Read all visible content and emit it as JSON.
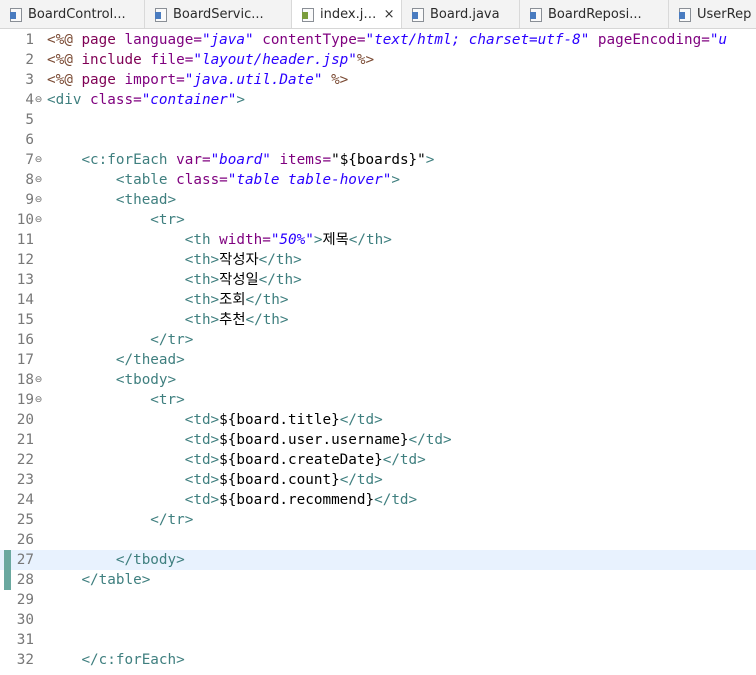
{
  "tabs": [
    {
      "label": "BoardControl...",
      "icon": "java-file-icon",
      "active": false
    },
    {
      "label": "BoardServic...",
      "icon": "java-file-icon",
      "active": false
    },
    {
      "label": "index.jsp",
      "icon": "jsp-file-icon",
      "active": true,
      "close": "×"
    },
    {
      "label": "Board.java",
      "icon": "java-file-icon",
      "active": false
    },
    {
      "label": "BoardReposi...",
      "icon": "java-file-icon",
      "active": false
    },
    {
      "label": "UserRep",
      "icon": "java-file-icon",
      "active": false
    }
  ],
  "editor": {
    "current_line": 27,
    "colors": {
      "current_line_bg": "#e8f2fe",
      "marker": "#6aa89f"
    },
    "lines": [
      {
        "n": "1",
        "fold": "",
        "segs": [
          [
            "c-dir",
            "<%@ "
          ],
          [
            "c-kw",
            "page "
          ],
          [
            "c-attr",
            "language="
          ],
          [
            "c-str",
            "\"java\" "
          ],
          [
            "c-attr",
            "contentType="
          ],
          [
            "c-str",
            "\"text/html; charset=utf-8\" "
          ],
          [
            "c-attr",
            "pageEncoding="
          ],
          [
            "c-str",
            "\"u"
          ]
        ]
      },
      {
        "n": "2",
        "fold": "",
        "segs": [
          [
            "c-dir",
            "<%@ "
          ],
          [
            "c-kw",
            "include "
          ],
          [
            "c-attr",
            "file="
          ],
          [
            "c-str",
            "\"layout/header.jsp\""
          ],
          [
            "c-dir",
            "%>"
          ]
        ]
      },
      {
        "n": "3",
        "fold": "",
        "segs": [
          [
            "c-dir",
            "<%@ "
          ],
          [
            "c-kw",
            "page "
          ],
          [
            "c-attr",
            "import="
          ],
          [
            "c-str",
            "\"java.util.Date\" "
          ],
          [
            "c-dir",
            "%>"
          ]
        ]
      },
      {
        "n": "4",
        "fold": "⊖",
        "segs": [
          [
            "c-tag",
            "<div "
          ],
          [
            "c-attr",
            "class="
          ],
          [
            "c-str",
            "\"container\""
          ],
          [
            "c-tag",
            ">"
          ]
        ]
      },
      {
        "n": "5",
        "fold": "",
        "segs": []
      },
      {
        "n": "6",
        "fold": "",
        "segs": []
      },
      {
        "n": "7",
        "fold": "⊖",
        "segs": [
          [
            "c-txt",
            "    "
          ],
          [
            "c-tag",
            "<c:forEach "
          ],
          [
            "c-attr",
            "var="
          ],
          [
            "c-str",
            "\"board\" "
          ],
          [
            "c-attr",
            "items="
          ],
          [
            "c-txt",
            "\"${boards}\""
          ],
          [
            "c-tag",
            ">"
          ]
        ]
      },
      {
        "n": "8",
        "fold": "⊖",
        "segs": [
          [
            "c-txt",
            "        "
          ],
          [
            "c-tag",
            "<table "
          ],
          [
            "c-attr",
            "class="
          ],
          [
            "c-str",
            "\"table table-hover\""
          ],
          [
            "c-tag",
            ">"
          ]
        ]
      },
      {
        "n": "9",
        "fold": "⊖",
        "segs": [
          [
            "c-txt",
            "        "
          ],
          [
            "c-tag",
            "<thead>"
          ]
        ]
      },
      {
        "n": "10",
        "fold": "⊖",
        "segs": [
          [
            "c-txt",
            "            "
          ],
          [
            "c-tag",
            "<tr>"
          ]
        ]
      },
      {
        "n": "11",
        "fold": "",
        "segs": [
          [
            "c-txt",
            "                "
          ],
          [
            "c-tag",
            "<th "
          ],
          [
            "c-attr",
            "width="
          ],
          [
            "c-str",
            "\"50%\""
          ],
          [
            "c-tag",
            ">"
          ],
          [
            "c-txt",
            "제목"
          ],
          [
            "c-tag",
            "</th>"
          ]
        ]
      },
      {
        "n": "12",
        "fold": "",
        "segs": [
          [
            "c-txt",
            "                "
          ],
          [
            "c-tag",
            "<th>"
          ],
          [
            "c-txt",
            "작성자"
          ],
          [
            "c-tag",
            "</th>"
          ]
        ]
      },
      {
        "n": "13",
        "fold": "",
        "segs": [
          [
            "c-txt",
            "                "
          ],
          [
            "c-tag",
            "<th>"
          ],
          [
            "c-txt",
            "작성일"
          ],
          [
            "c-tag",
            "</th>"
          ]
        ]
      },
      {
        "n": "14",
        "fold": "",
        "segs": [
          [
            "c-txt",
            "                "
          ],
          [
            "c-tag",
            "<th>"
          ],
          [
            "c-txt",
            "조회"
          ],
          [
            "c-tag",
            "</th>"
          ]
        ]
      },
      {
        "n": "15",
        "fold": "",
        "segs": [
          [
            "c-txt",
            "                "
          ],
          [
            "c-tag",
            "<th>"
          ],
          [
            "c-txt",
            "추천"
          ],
          [
            "c-tag",
            "</th>"
          ]
        ]
      },
      {
        "n": "16",
        "fold": "",
        "segs": [
          [
            "c-txt",
            "            "
          ],
          [
            "c-tag",
            "</tr>"
          ]
        ]
      },
      {
        "n": "17",
        "fold": "",
        "segs": [
          [
            "c-txt",
            "        "
          ],
          [
            "c-tag",
            "</thead>"
          ]
        ]
      },
      {
        "n": "18",
        "fold": "⊖",
        "segs": [
          [
            "c-txt",
            "        "
          ],
          [
            "c-tag",
            "<tbody>"
          ]
        ]
      },
      {
        "n": "19",
        "fold": "⊖",
        "segs": [
          [
            "c-txt",
            "            "
          ],
          [
            "c-tag",
            "<tr>"
          ]
        ]
      },
      {
        "n": "20",
        "fold": "",
        "segs": [
          [
            "c-txt",
            "                "
          ],
          [
            "c-tag",
            "<td>"
          ],
          [
            "c-txt",
            "${board.title}"
          ],
          [
            "c-tag",
            "</td>"
          ]
        ]
      },
      {
        "n": "21",
        "fold": "",
        "segs": [
          [
            "c-txt",
            "                "
          ],
          [
            "c-tag",
            "<td>"
          ],
          [
            "c-txt",
            "${board.user.username}"
          ],
          [
            "c-tag",
            "</td>"
          ]
        ]
      },
      {
        "n": "22",
        "fold": "",
        "segs": [
          [
            "c-txt",
            "                "
          ],
          [
            "c-tag",
            "<td>"
          ],
          [
            "c-txt",
            "${board.createDate}"
          ],
          [
            "c-tag",
            "</td>"
          ]
        ]
      },
      {
        "n": "23",
        "fold": "",
        "segs": [
          [
            "c-txt",
            "                "
          ],
          [
            "c-tag",
            "<td>"
          ],
          [
            "c-txt",
            "${board.count}"
          ],
          [
            "c-tag",
            "</td>"
          ]
        ]
      },
      {
        "n": "24",
        "fold": "",
        "segs": [
          [
            "c-txt",
            "                "
          ],
          [
            "c-tag",
            "<td>"
          ],
          [
            "c-txt",
            "${board.recommend}"
          ],
          [
            "c-tag",
            "</td>"
          ]
        ]
      },
      {
        "n": "25",
        "fold": "",
        "segs": [
          [
            "c-txt",
            "            "
          ],
          [
            "c-tag",
            "</tr>"
          ]
        ]
      },
      {
        "n": "26",
        "fold": "",
        "segs": []
      },
      {
        "n": "27",
        "fold": "",
        "segs": [
          [
            "c-txt",
            "        "
          ],
          [
            "c-tag",
            "</tbody>"
          ]
        ]
      },
      {
        "n": "28",
        "fold": "",
        "segs": [
          [
            "c-txt",
            "    "
          ],
          [
            "c-tag",
            "</table>"
          ]
        ]
      },
      {
        "n": "29",
        "fold": "",
        "segs": []
      },
      {
        "n": "30",
        "fold": "",
        "segs": []
      },
      {
        "n": "31",
        "fold": "",
        "segs": []
      },
      {
        "n": "32",
        "fold": "",
        "segs": [
          [
            "c-txt",
            "    "
          ],
          [
            "c-tag",
            "</c:forEach>"
          ]
        ]
      }
    ]
  }
}
